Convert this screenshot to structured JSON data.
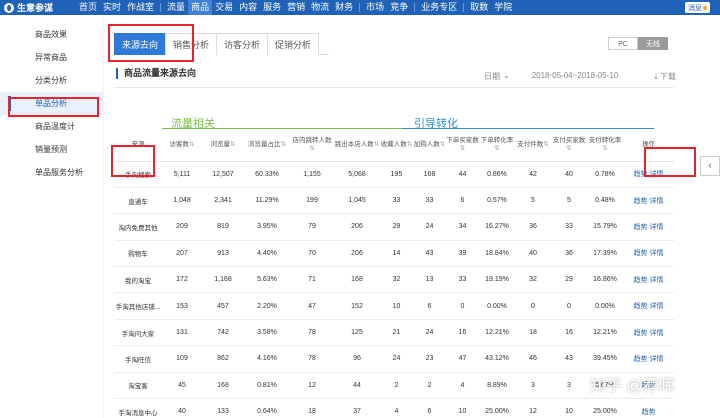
{
  "topbar": {
    "logo": "生意参谋",
    "nav": [
      "首页",
      "实时",
      "作战室",
      "流量",
      "商品",
      "交易",
      "内容",
      "服务",
      "营销",
      "物流",
      "财务",
      "市场",
      "竞争",
      "业务专区",
      "取数",
      "学院"
    ],
    "message": "消息"
  },
  "sidebar": {
    "items": [
      "商品效果",
      "异常商品",
      "分类分析",
      "单品分析",
      "商品温度计",
      "销量预测",
      "单品服务分析"
    ]
  },
  "tabs": [
    "来源去向",
    "销售分析",
    "访客分析",
    "促销分析"
  ],
  "device": [
    "PC",
    "无线"
  ],
  "section_title": "商品流量来源去向",
  "date": {
    "label": "日期",
    "range": "2018-05-04~2018-05-10"
  },
  "download": "下载",
  "groups": {
    "traffic": "流量相关",
    "conversion": "引导转化"
  },
  "columns": [
    "来源",
    "访客数",
    "浏览量",
    "浏览量占比",
    "店内跳转人数",
    "跳出本店人数",
    "收藏人数",
    "加购人数",
    "下单买家数",
    "下单转化率",
    "支付件数",
    "支付买家数",
    "支付转化率",
    "操作"
  ],
  "rows": [
    [
      "手淘搜索",
      "5,111",
      "12,507",
      "60.33%",
      "1,155",
      "5,068",
      "195",
      "168",
      "44",
      "0.86%",
      "42",
      "40",
      "0.78%"
    ],
    [
      "直通车",
      "1,048",
      "2,341",
      "11.29%",
      "199",
      "1,045",
      "33",
      "33",
      "6",
      "0.57%",
      "5",
      "5",
      "0.48%"
    ],
    [
      "淘内免费其他",
      "209",
      "819",
      "3.95%",
      "79",
      "206",
      "29",
      "24",
      "34",
      "16.27%",
      "36",
      "33",
      "15.79%"
    ],
    [
      "购物车",
      "207",
      "913",
      "4.40%",
      "70",
      "206",
      "14",
      "43",
      "39",
      "18.84%",
      "40",
      "36",
      "17.39%"
    ],
    [
      "我的淘宝",
      "172",
      "1,168",
      "5.63%",
      "71",
      "168",
      "32",
      "13",
      "33",
      "19.19%",
      "32",
      "29",
      "16.86%"
    ],
    [
      "手淘其他店铺...",
      "153",
      "457",
      "2.20%",
      "47",
      "152",
      "10",
      "6",
      "0",
      "0.00%",
      "0",
      "0",
      "0.00%"
    ],
    [
      "手淘问大家",
      "131",
      "742",
      "3.58%",
      "78",
      "125",
      "21",
      "24",
      "16",
      "12.21%",
      "18",
      "16",
      "12.21%"
    ],
    [
      "手淘旺信",
      "109",
      "862",
      "4.16%",
      "78",
      "96",
      "24",
      "23",
      "47",
      "43.12%",
      "46",
      "43",
      "39.45%"
    ],
    [
      "淘宝客",
      "45",
      "168",
      "0.81%",
      "12",
      "44",
      "2",
      "2",
      "4",
      "8.89%",
      "3",
      "3",
      "6.67%"
    ],
    [
      "手淘消息中心",
      "40",
      "133",
      "0.64%",
      "18",
      "37",
      "4",
      "6",
      "10",
      "25.00%",
      "12",
      "10",
      "25.00%"
    ]
  ],
  "actions": {
    "trend": "趋势",
    "detail": "详情"
  },
  "watermark": "知乎 @荐晖",
  "colors": {
    "brand": "#2062b8",
    "tab_active": "#2f7ad9",
    "traffic": "#7bc142",
    "conversion": "#2e8fd6",
    "highlight": "#e8232d"
  }
}
